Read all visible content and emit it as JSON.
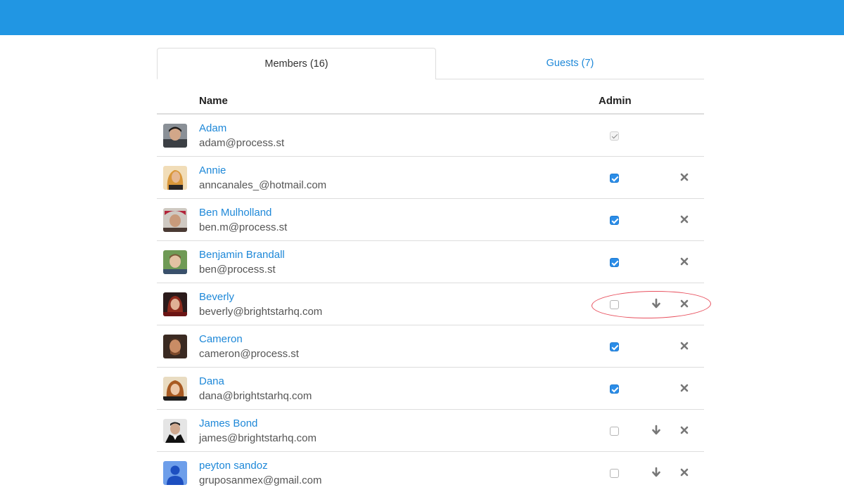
{
  "tabs": {
    "members_label": "Members (16)",
    "guests_label": "Guests (7)"
  },
  "table": {
    "col_name": "Name",
    "col_admin": "Admin"
  },
  "members": [
    {
      "name": "Adam",
      "email": "adam@process.st",
      "admin": "checked-disabled",
      "show_demote": false,
      "show_remove": false
    },
    {
      "name": "Annie",
      "email": "anncanales_@hotmail.com",
      "admin": "checked",
      "show_demote": false,
      "show_remove": true
    },
    {
      "name": "Ben Mulholland",
      "email": "ben.m@process.st",
      "admin": "checked",
      "show_demote": false,
      "show_remove": true
    },
    {
      "name": "Benjamin Brandall",
      "email": "ben@process.st",
      "admin": "checked",
      "show_demote": false,
      "show_remove": true
    },
    {
      "name": "Beverly",
      "email": "beverly@brightstarhq.com",
      "admin": "unchecked",
      "show_demote": true,
      "show_remove": true
    },
    {
      "name": "Cameron",
      "email": "cameron@process.st",
      "admin": "checked",
      "show_demote": false,
      "show_remove": true
    },
    {
      "name": "Dana",
      "email": "dana@brightstarhq.com",
      "admin": "checked",
      "show_demote": false,
      "show_remove": true
    },
    {
      "name": "James Bond",
      "email": "james@brightstarhq.com",
      "admin": "unchecked",
      "show_demote": true,
      "show_remove": true
    },
    {
      "name": "peyton sandoz",
      "email": "gruposanmex@gmail.com",
      "admin": "unchecked",
      "show_demote": true,
      "show_remove": true
    }
  ],
  "colors": {
    "topbar": "#2196e3",
    "link": "#1e88d8",
    "checkbox_checked": "#2b8de8",
    "highlight_annotation": "#e8505e",
    "action_icon": "#777777"
  },
  "icons": {
    "demote": "arrow-down-icon",
    "remove": "close-icon"
  }
}
